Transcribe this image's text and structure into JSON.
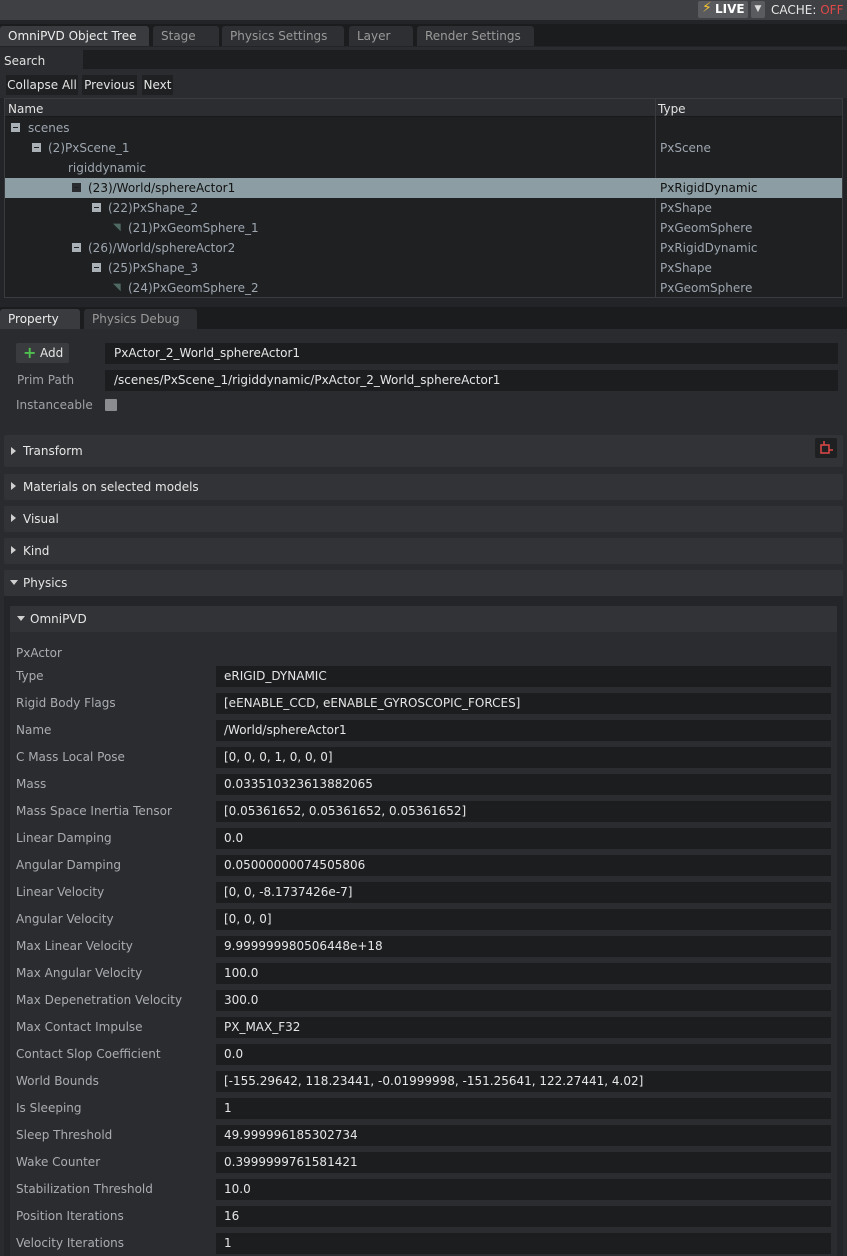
{
  "topbar": {
    "live_label": "LIVE",
    "live_icon": "lightning-bolt-icon",
    "cache_label": "CACHE:",
    "cache_state": "OFF",
    "cache_state_color": "#e04848"
  },
  "panel_tabs": [
    "OmniPVD Object Tree",
    "Stage",
    "Physics Settings",
    "Layer",
    "Render Settings"
  ],
  "search": {
    "label": "Search",
    "value": ""
  },
  "tree_buttons": {
    "collapse_all": "Collapse All",
    "previous": "Previous",
    "next": "Next"
  },
  "tree": {
    "col_name": "Name",
    "col_type": "Type",
    "rows": [
      {
        "name": "scenes",
        "type": ""
      },
      {
        "name": "(2)PxScene_1",
        "type": "PxScene"
      },
      {
        "name": "rigiddynamic",
        "type": ""
      },
      {
        "name": "(23)/World/sphereActor1",
        "type": "PxRigidDynamic",
        "selected": true
      },
      {
        "name": "(22)PxShape_2",
        "type": "PxShape"
      },
      {
        "name": "(21)PxGeomSphere_1",
        "type": "PxGeomSphere"
      },
      {
        "name": "(26)/World/sphereActor2",
        "type": "PxRigidDynamic"
      },
      {
        "name": "(25)PxShape_3",
        "type": "PxShape"
      },
      {
        "name": "(24)PxGeomSphere_2",
        "type": "PxGeomSphere"
      }
    ]
  },
  "property_tabs": [
    "Property",
    "Physics Debug"
  ],
  "prim": {
    "add_label": "Add",
    "name_value": "PxActor_2_World_sphereActor1",
    "path_label": "Prim Path",
    "path_value": "/scenes/PxScene_1/rigiddynamic/PxActor_2_World_sphereActor1",
    "instanceable_label": "Instanceable"
  },
  "sections": {
    "transform": "Transform",
    "materials": "Materials on selected models",
    "visual": "Visual",
    "kind": "Kind",
    "physics": "Physics",
    "omnipvd": "OmniPVD"
  },
  "pxactor_label": "PxActor",
  "properties": [
    {
      "label": "Type",
      "value": "eRIGID_DYNAMIC"
    },
    {
      "label": "Rigid Body Flags",
      "value": "[eENABLE_CCD, eENABLE_GYROSCOPIC_FORCES]"
    },
    {
      "label": "Name",
      "value": "/World/sphereActor1"
    },
    {
      "label": "C Mass Local Pose",
      "value": "[0, 0, 0, 1, 0, 0, 0]"
    },
    {
      "label": "Mass",
      "value": "0.033510323613882065"
    },
    {
      "label": "Mass Space Inertia Tensor",
      "value": "[0.05361652, 0.05361652, 0.05361652]"
    },
    {
      "label": "Linear Damping",
      "value": "0.0"
    },
    {
      "label": "Angular Damping",
      "value": "0.05000000074505806"
    },
    {
      "label": "Linear Velocity",
      "value": "[0, 0, -8.1737426e-7]"
    },
    {
      "label": "Angular Velocity",
      "value": "[0, 0, 0]"
    },
    {
      "label": "Max Linear Velocity",
      "value": "9.999999980506448e+18"
    },
    {
      "label": "Max Angular Velocity",
      "value": "100.0"
    },
    {
      "label": "Max Depenetration Velocity",
      "value": "300.0"
    },
    {
      "label": "Max Contact Impulse",
      "value": "PX_MAX_F32"
    },
    {
      "label": "Contact Slop Coefficient",
      "value": "0.0"
    },
    {
      "label": "World Bounds",
      "value": "[-155.29642, 118.23441, -0.01999998, -151.25641, 122.27441, 4.02]"
    },
    {
      "label": "Is Sleeping",
      "value": "1"
    },
    {
      "label": "Sleep Threshold",
      "value": "49.999996185302734"
    },
    {
      "label": "Wake Counter",
      "value": "0.3999999761581421"
    },
    {
      "label": "Stabilization Threshold",
      "value": "10.0"
    },
    {
      "label": "Position Iterations",
      "value": "16"
    },
    {
      "label": "Velocity Iterations",
      "value": "1"
    }
  ]
}
